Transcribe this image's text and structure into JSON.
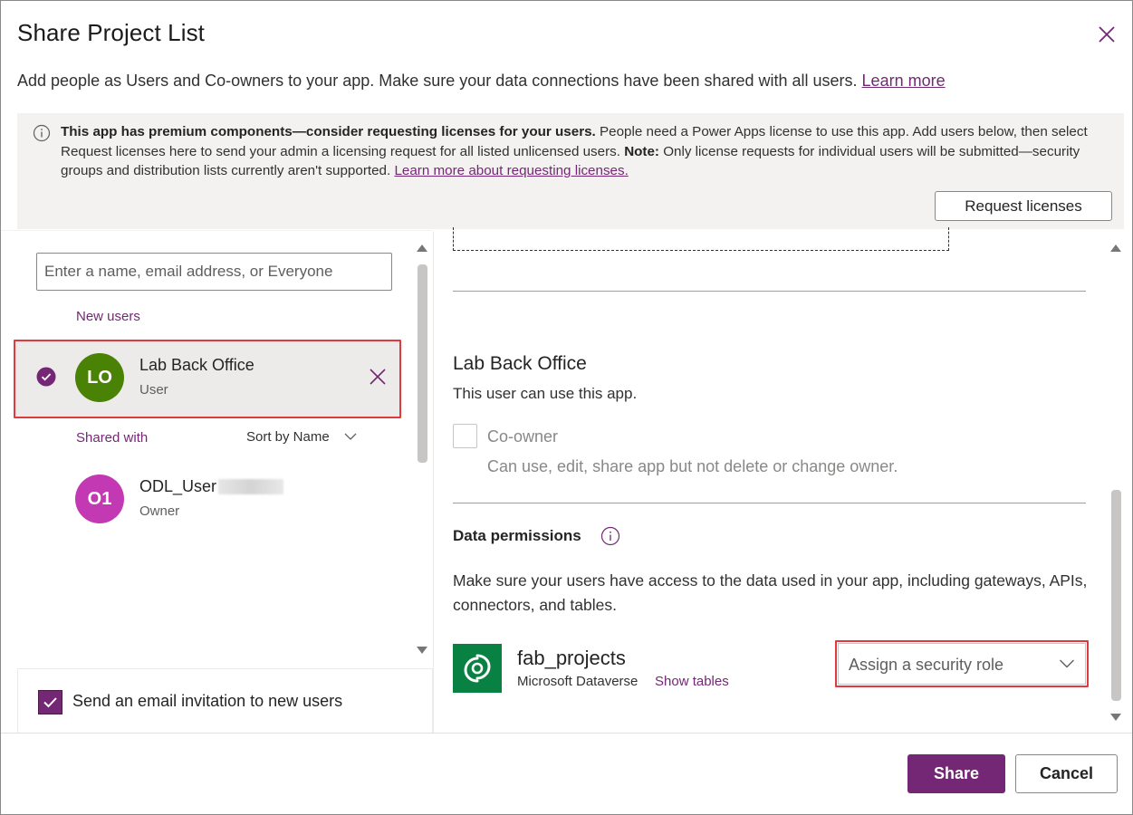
{
  "dialog": {
    "title": "Share Project List",
    "subtitle": "Add people as Users and Co-owners to your app. Make sure your data connections have been shared with all users.",
    "subtitle_link": "Learn more"
  },
  "banner": {
    "bold": "This app has premium components—consider requesting licenses for your users.",
    "text1": " People need a Power Apps license to use this app. Add users below, then select Request licenses here to send your admin a licensing request for all listed unlicensed users. ",
    "note_label": "Note:",
    "text2": " Only license requests for individual users will be submitted—security groups and distribution lists currently aren't supported. ",
    "link": "Learn more about requesting licenses.",
    "button": "Request licenses"
  },
  "left": {
    "search_placeholder": "Enter a name, email address, or Everyone",
    "new_users_label": "New users",
    "new_user": {
      "initials": "LO",
      "name": "Lab Back Office",
      "role": "User",
      "avatar_color": "#498205"
    },
    "shared_with_label": "Shared with",
    "sort_label": "Sort by Name",
    "shared_user": {
      "initials": "O1",
      "name": "ODL_User",
      "role": "Owner",
      "avatar_color": "#c239b3"
    },
    "email_invite_label": "Send an email invitation to new users",
    "email_invite_checked": true
  },
  "right": {
    "user_name": "Lab Back Office",
    "user_desc": "This user can use this app.",
    "coowner_label": "Co-owner",
    "coowner_desc": "Can use, edit, share app but not delete or change owner.",
    "data_permissions_title": "Data permissions",
    "data_permissions_desc": "Make sure your users have access to the data used in your app, including gateways, APIs, connectors, and tables.",
    "table_name": "fab_projects",
    "table_source": "Microsoft Dataverse",
    "show_tables": "Show tables",
    "security_role_placeholder": "Assign a security role"
  },
  "footer": {
    "share": "Share",
    "cancel": "Cancel"
  },
  "colors": {
    "accent": "#742774",
    "highlight_border": "#e0393e",
    "dataverse_tile": "#088142"
  }
}
